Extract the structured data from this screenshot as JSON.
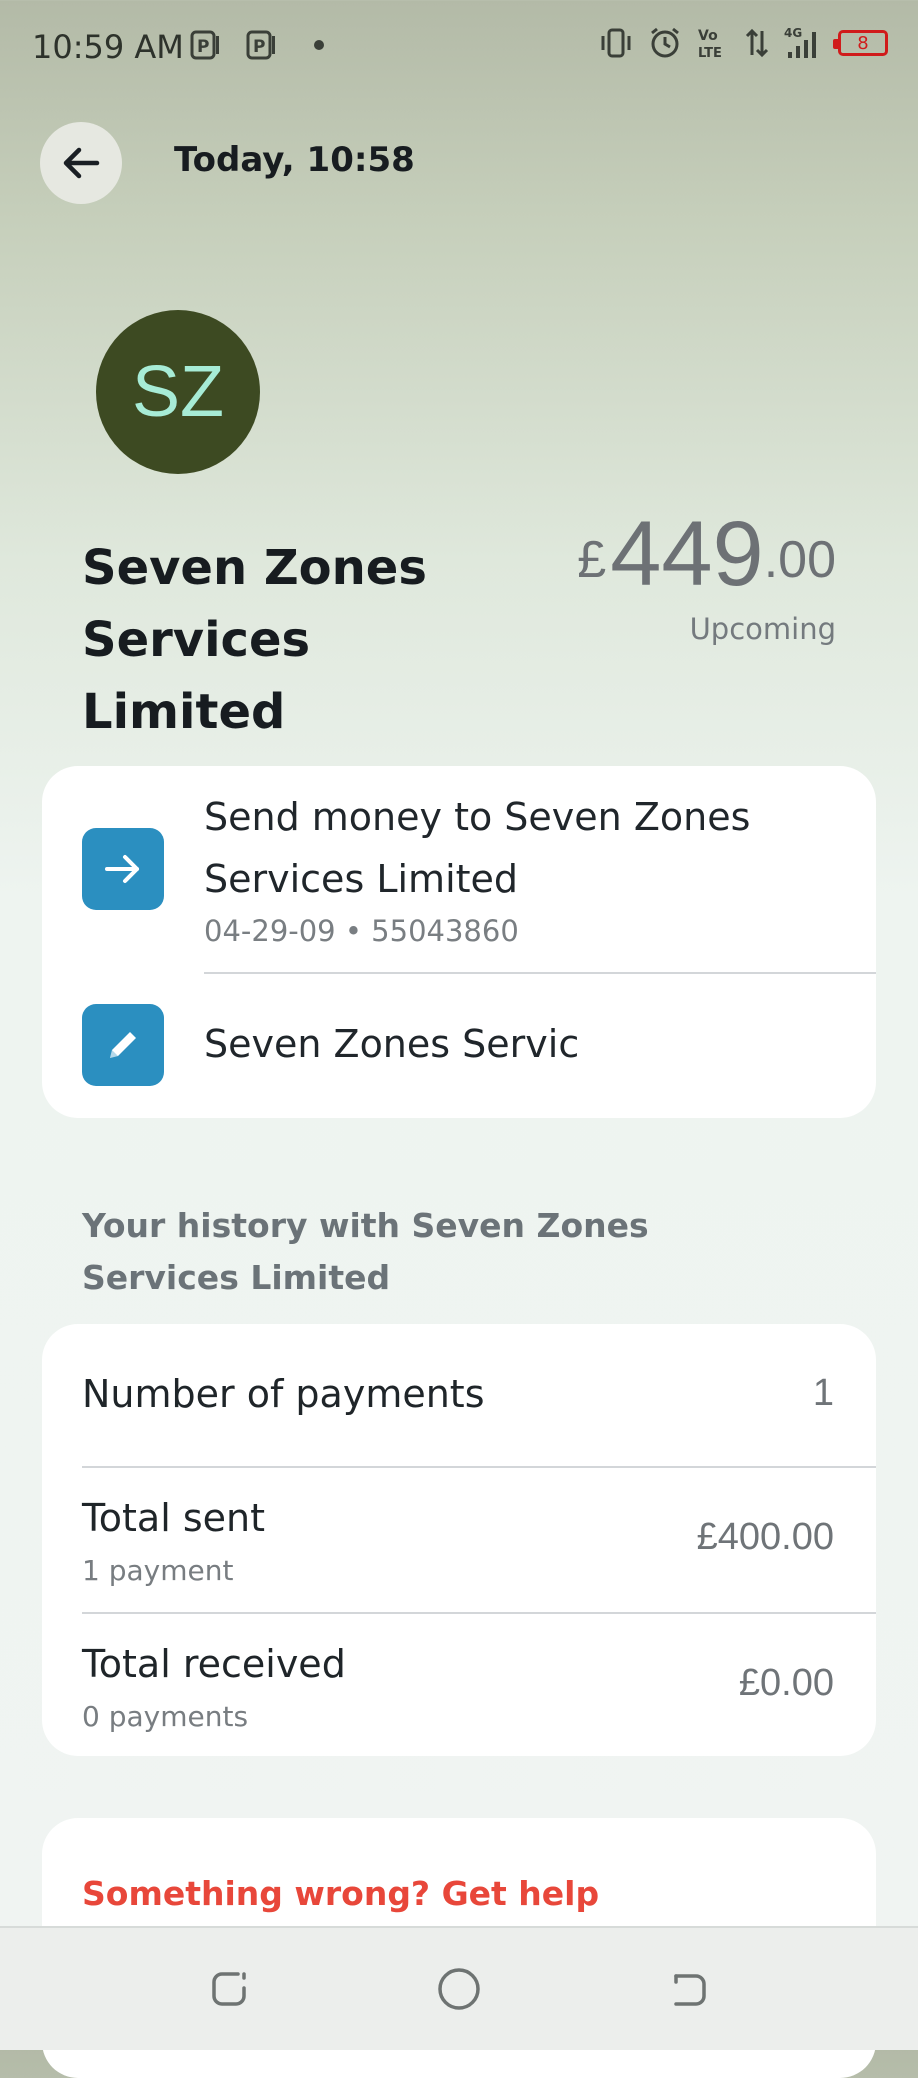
{
  "status_bar": {
    "time": "10:59 AM",
    "battery_level": "8",
    "icons": [
      "parking-app-icon",
      "parking-app-icon",
      "notification-dot",
      "vibrate-icon",
      "alarm-icon",
      "volte-icon",
      "data-arrows-icon",
      "signal-4g-icon",
      "battery-icon"
    ]
  },
  "header": {
    "title": "Today, 10:58",
    "back_icon": "arrow-left-icon"
  },
  "merchant": {
    "initials": "SZ",
    "name": "Seven Zones Services Limited",
    "avatar_bg": "#3d4a22",
    "avatar_text": "#a7ecd6"
  },
  "amount": {
    "currency": "£",
    "integer": "449",
    "decimal": ".00",
    "status": "Upcoming"
  },
  "actions": {
    "send": {
      "icon": "arrow-right-icon",
      "title": "Send money to Seven Zones Services Limited",
      "subtitle": "04-29-09 • 55043860"
    },
    "edit": {
      "icon": "pencil-icon",
      "label": "Seven Zones Servic"
    },
    "accent": "#2b8fc0"
  },
  "history": {
    "title": "Your history with Seven Zones Services Limited",
    "rows": [
      {
        "label": "Number of payments",
        "value": "1"
      },
      {
        "label": "Total sent",
        "sub": "1 payment",
        "value": "£400.00"
      },
      {
        "label": "Total received",
        "sub": "0 payments",
        "value": "£0.00"
      }
    ]
  },
  "help": {
    "label": "Something wrong? Get help",
    "color": "#e8473a"
  },
  "nav_bar": {
    "buttons": [
      "recent-apps-button",
      "home-button",
      "back-button"
    ]
  }
}
